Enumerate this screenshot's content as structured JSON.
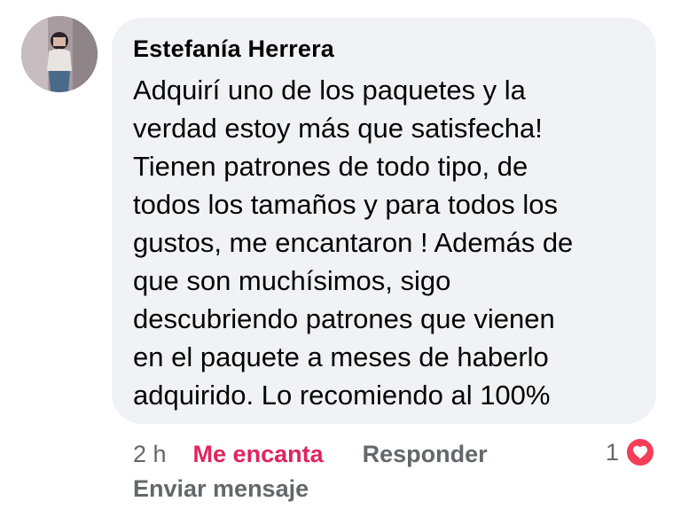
{
  "comment": {
    "author": "Estefanía Herrera",
    "lines": [
      "Adquirí uno de los paquetes y la",
      "verdad estoy más que satisfecha!",
      "Tienen patrones de todo tipo, de",
      "todos los tamaños y para todos los",
      "gustos, me encantaron ! Además de",
      "que son muchísimos, sigo",
      "descubriendo patrones que vienen",
      "en el paquete a meses de haberlo",
      "adquirido. Lo recomiendo al 100%"
    ],
    "time": "2 h",
    "reaction_label": "Me encanta",
    "reply_label": "Responder",
    "reaction_count": "1",
    "send_message_label": "Enviar mensaje"
  },
  "colors": {
    "bubble_bg": "#f0f2f5",
    "love_red": "#f33e58",
    "reaction_text": "#e0245e",
    "secondary_text": "#65676b"
  },
  "icons": {
    "reaction_badge": "heart-icon",
    "avatar": "user-avatar"
  }
}
